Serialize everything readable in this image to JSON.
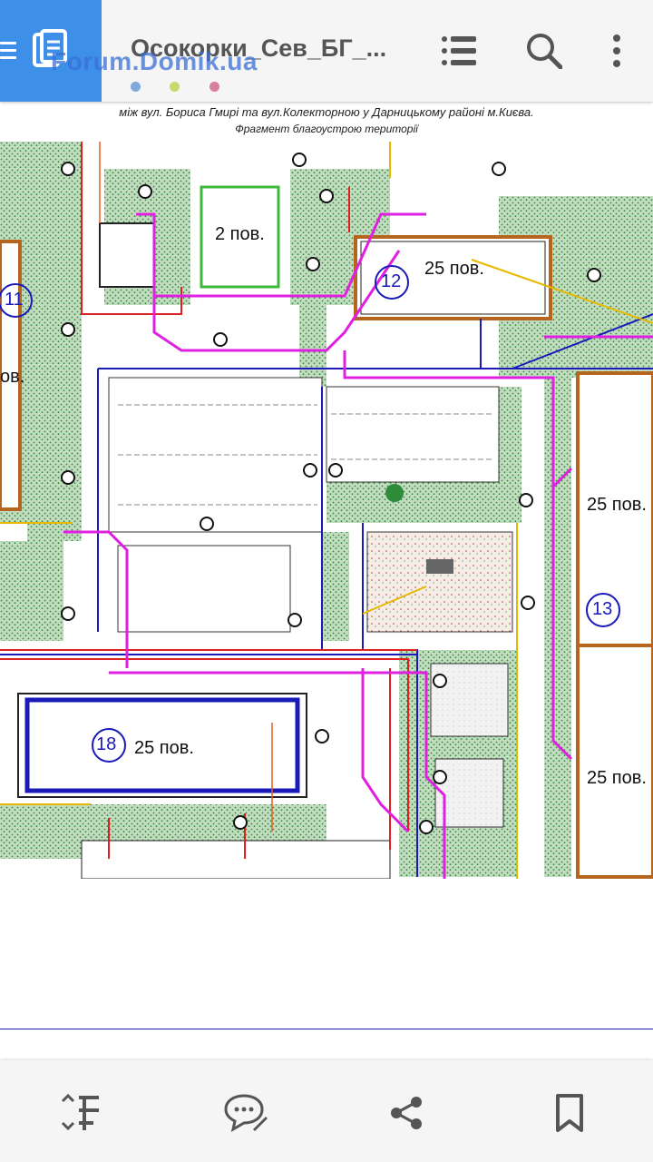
{
  "app": {
    "title": "Осокорки_Сев_БГ_...",
    "watermark": "Forum.Domik.ua",
    "accent_color": "#3d8fe8",
    "indicator_colors": [
      "#7fa9d8",
      "#c9d86b",
      "#d87f9a"
    ]
  },
  "toolbar": {
    "menu_icon": "menu-icon",
    "document_icon": "document-icon",
    "list_icon": "list-icon",
    "search_icon": "search-icon",
    "more_icon": "more-vertical-icon"
  },
  "document": {
    "header_line1": "між вул. Бориса Гмирі та вул.Колекторною у Дарницькому районі м.Києва.",
    "header_line2": "Фрагмент благоустрою території",
    "labels": {
      "building_2": "2 пов.",
      "building_12_floors": "25 пов.",
      "building_12_num": "12",
      "building_13_floors": "25 пов.",
      "building_13_num": "13",
      "building_13b_floors": "25 пов.",
      "building_18_floors": "25 пов.",
      "building_18_num": "18",
      "building_11_num": "11",
      "building_11_floors": "ов."
    }
  },
  "bottombar": {
    "reflow_icon": "text-reflow-icon",
    "comment_icon": "comment-edit-icon",
    "share_icon": "share-icon",
    "bookmark_icon": "bookmark-icon"
  }
}
